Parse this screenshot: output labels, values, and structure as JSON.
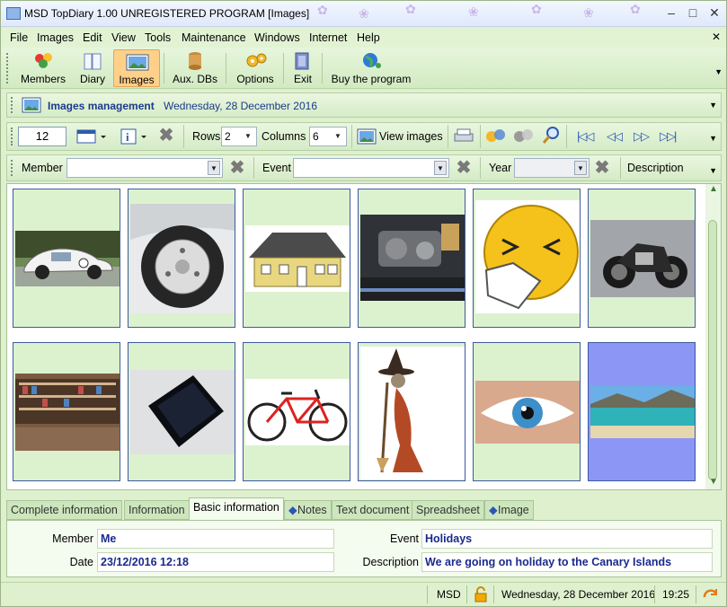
{
  "window": {
    "title": "MSD TopDiary 1.00 UNREGISTERED PROGRAM [Images]"
  },
  "menu": [
    "File",
    "Images",
    "Edit",
    "View",
    "Tools",
    "Maintenance",
    "Windows",
    "Internet",
    "Help"
  ],
  "toolbar": {
    "members": "Members",
    "diary": "Diary",
    "images": "Images",
    "aux": "Aux. DBs",
    "options": "Options",
    "exit": "Exit",
    "buy": "Buy the program"
  },
  "header": {
    "title": "Images management",
    "date": "Wednesday, 28 December 2016"
  },
  "controls": {
    "count": "12",
    "rows_label": "Rows",
    "rows_value": "2",
    "columns_label": "Columns",
    "columns_value": "6",
    "view_images": "View images"
  },
  "filters": {
    "member_label": "Member",
    "member_value": "",
    "event_label": "Event",
    "event_value": "",
    "year_label": "Year",
    "year_value": "",
    "description_label": "Description"
  },
  "tabs": [
    "Complete information",
    "Information",
    "Basic information",
    "Notes",
    "Text document",
    "Spreadsheet",
    "Image"
  ],
  "details": {
    "member_label": "Member",
    "member_value": "Me",
    "date_label": "Date",
    "date_value": "23/12/2016 12:18",
    "event_label": "Event",
    "event_value": "Holidays",
    "description_label": "Description",
    "description_value": "We are going on holiday to the Canary Islands"
  },
  "status": {
    "user": "MSD",
    "date": "Wednesday, 28 December 2016",
    "time": "19:25"
  }
}
